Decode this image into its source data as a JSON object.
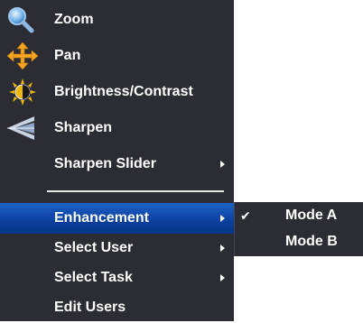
{
  "menu": {
    "items": [
      {
        "label": "Zoom",
        "icon": "magnifier-icon"
      },
      {
        "label": "Pan",
        "icon": "pan-arrows-icon"
      },
      {
        "label": "Brightness/Contrast",
        "icon": "sun-contrast-icon"
      },
      {
        "label": "Sharpen",
        "icon": "sharpen-icon"
      },
      {
        "label": "Sharpen Slider",
        "submenu": true
      },
      {
        "label": "Enhancement",
        "submenu": true,
        "selected": true
      },
      {
        "label": "Select User",
        "submenu": true
      },
      {
        "label": "Select Task",
        "submenu": true
      },
      {
        "label": "Edit Users"
      }
    ]
  },
  "submenu": {
    "items": [
      {
        "label": "Mode A",
        "checked": true,
        "check_glyph": "✔"
      },
      {
        "label": "Mode B",
        "checked": false
      }
    ]
  },
  "colors": {
    "menu_bg": "#2b2c34",
    "selected_bg": "#0b3f9d",
    "text": "#ffffff",
    "pan_orange": "#f5a623"
  }
}
